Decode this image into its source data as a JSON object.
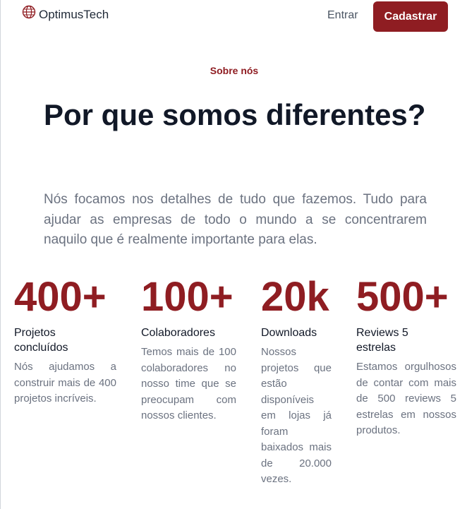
{
  "header": {
    "brand": "OptimusTech",
    "login_label": "Entrar",
    "signup_label": "Cadastrar",
    "accent_color": "#8f1d22"
  },
  "hero": {
    "eyebrow": "Sobre nós",
    "title": "Por que somos diferentes?",
    "lead": "Nós focamos nos detalhes de tudo que fazemos. Tudo para ajudar as empresas de todo o mundo a se concentrarem naquilo que é realmente importante para elas."
  },
  "stats": [
    {
      "value": "400+",
      "label": "Projetos concluídos",
      "description": "Nós ajudamos a construir mais de 400 projetos incríveis."
    },
    {
      "value": "100+",
      "label": "Colaboradores",
      "description": "Temos mais de 100 colaboradores no nosso time que se preocupam com nossos clientes."
    },
    {
      "value": "20k",
      "label": "Downloads",
      "description": "Nossos projetos que estão disponíveis em lojas já foram baixados mais de 20.000 vezes."
    },
    {
      "value": "500+",
      "label": "Reviews 5 estrelas",
      "description": "Estamos orgulhosos de contar com mais de 500 reviews 5 estrelas em nossos produtos."
    }
  ]
}
